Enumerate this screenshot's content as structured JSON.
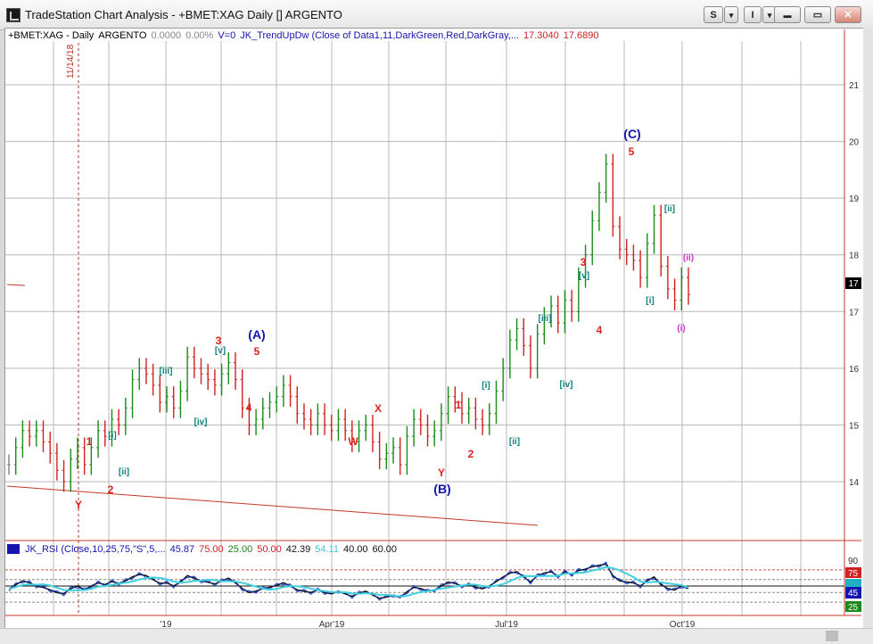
{
  "window": {
    "title": "TradeStation Chart Analysis - +BMET:XAG Daily [] ARGENTO",
    "btn_s": "S",
    "btn_arrow": "▾",
    "btn_i": "I",
    "btn_min": "▬",
    "btn_max": "▭",
    "btn_close": "✕"
  },
  "header": {
    "symbol": "+BMET:XAG - Daily",
    "name": "ARGENTO",
    "change": "0.0000",
    "change_pct": "0.00%",
    "volume": "V=0",
    "study": "JK_TrendUpDw",
    "study_params": "(Close of Data1,11,DarkGreen,Red,DarkGray,...",
    "v1": "17.3040",
    "v2": "17.6890"
  },
  "rsi_header": {
    "label": "JK_RSI (Close,10,25,75,\"S\",5,...",
    "v1": "45.87",
    "v2": "75.00",
    "v3": "25.00",
    "v4": "50.00",
    "v5": "42.39",
    "v6": "54.11",
    "v7": "40.00",
    "v8": "60.00"
  },
  "price_axis": [
    "21",
    "20",
    "19",
    "18",
    "17",
    "16",
    "15",
    "14"
  ],
  "price_marker": "17",
  "rsi_axis": {
    "top": "90",
    "m75": "75",
    "m60": "60",
    "m45": "45",
    "m25": "25"
  },
  "date_axis": [
    "'19",
    "Apr'19",
    "Jul'19",
    "Oct'19"
  ],
  "date_marker": "11/14/18",
  "wave_labels": {
    "y1": "Y",
    "w1": "1",
    "w2": "2",
    "wi": "[i]",
    "wii": "[ii]",
    "wiii": "[iii]",
    "wiv": "[iv]",
    "w3a": "3",
    "wva": "[v]",
    "A": "(A)",
    "w5a": "5",
    "w4a": "4",
    "W": "W",
    "X": "X",
    "Y2": "Y",
    "B": "(B)",
    "b1": "1",
    "b2": "2",
    "bi": "[i]",
    "bii": "[ii]",
    "biii": "[iii]",
    "biv": "[iv]",
    "b3": "3",
    "bv": "[v]",
    "b4": "4",
    "C": "(C)",
    "b5": "5",
    "ci": "[i]",
    "cii": "[ii]",
    "pi": "(i)",
    "pii": "(ii)"
  },
  "colors": {
    "up_bar": "#1a8a1a",
    "down_bar": "#d22020",
    "neutral_bar": "#7f7f7f",
    "red_label": "#e02020",
    "teal_label": "#108080",
    "blue_label": "#1515b0",
    "magenta_label": "#cc33cc"
  },
  "chart_data": {
    "type": "ohlc",
    "title": "+BMET:XAG - Daily",
    "y_range": [
      13.0,
      22.0
    ],
    "x_labels": [
      "'19",
      "Apr'19",
      "Jul'19",
      "Oct'19"
    ],
    "close": [
      14.3,
      14.6,
      14.9,
      14.8,
      14.9,
      14.7,
      14.5,
      14.2,
      14.0,
      14.4,
      14.6,
      14.3,
      14.6,
      14.9,
      14.8,
      15.1,
      15.0,
      15.3,
      15.8,
      16.0,
      15.9,
      15.7,
      15.4,
      15.5,
      15.3,
      15.6,
      16.2,
      16.0,
      15.9,
      15.8,
      15.7,
      15.9,
      16.1,
      15.8,
      15.3,
      15.0,
      15.1,
      15.3,
      15.4,
      15.5,
      15.7,
      15.5,
      15.2,
      15.1,
      15.0,
      15.2,
      15.0,
      14.9,
      15.1,
      14.9,
      14.7,
      14.9,
      15.0,
      14.7,
      14.4,
      14.5,
      14.6,
      14.3,
      14.8,
      15.1,
      15.0,
      14.8,
      14.9,
      15.2,
      15.5,
      15.4,
      15.2,
      15.3,
      15.1,
      15.0,
      15.2,
      15.6,
      16.0,
      16.5,
      16.7,
      16.4,
      16.0,
      16.6,
      16.9,
      17.1,
      16.8,
      17.2,
      17.0,
      17.6,
      18.0,
      18.6,
      19.1,
      19.6,
      18.5,
      18.1,
      18.0,
      17.9,
      17.6,
      18.2,
      18.7,
      17.8,
      17.4,
      17.2,
      17.6,
      17.3
    ],
    "rsi": [
      45,
      52,
      58,
      55,
      50,
      48,
      44,
      40,
      38,
      46,
      50,
      44,
      50,
      55,
      52,
      57,
      54,
      58,
      64,
      68,
      66,
      60,
      54,
      55,
      50,
      56,
      66,
      62,
      58,
      56,
      53,
      58,
      62,
      55,
      46,
      40,
      42,
      46,
      48,
      51,
      55,
      50,
      44,
      42,
      40,
      44,
      40,
      38,
      42,
      38,
      34,
      39,
      42,
      36,
      31,
      33,
      36,
      32,
      41,
      48,
      46,
      42,
      44,
      50,
      56,
      54,
      50,
      52,
      48,
      46,
      50,
      57,
      64,
      70,
      72,
      64,
      56,
      66,
      70,
      72,
      65,
      72,
      68,
      74,
      76,
      80,
      82,
      84,
      66,
      58,
      56,
      55,
      50,
      58,
      64,
      52,
      46,
      44,
      50,
      46
    ],
    "rsi_ref_lines": [
      75,
      60,
      50,
      40,
      25
    ]
  }
}
